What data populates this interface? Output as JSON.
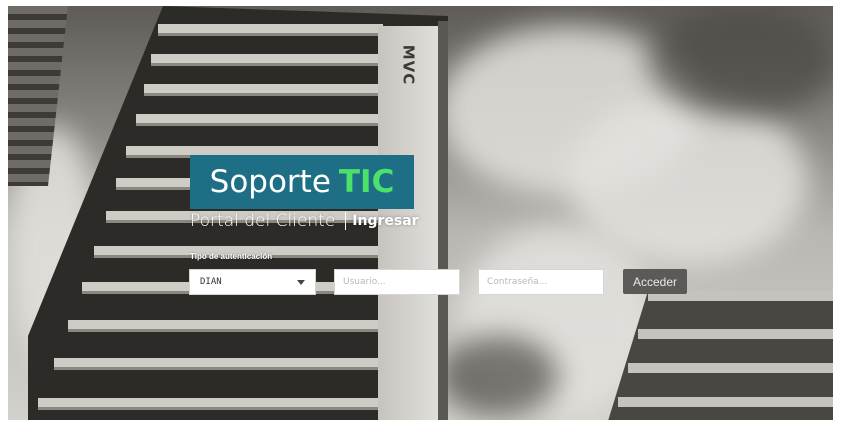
{
  "brand": {
    "name": "Soporte",
    "highlight": "TIC",
    "box_color": "#1e6f86",
    "highlight_color": "#4be26a"
  },
  "subtitle": {
    "text": "Portal del Cliente",
    "link": "Ingresar"
  },
  "login": {
    "auth_type_label": "Tipo de autenticación",
    "auth_type_value": "DIAN",
    "username_placeholder": "Usuario...",
    "password_placeholder": "Contraseña...",
    "submit_label": "Acceder"
  },
  "background": {
    "building_sign": "MVC"
  },
  "icons": {
    "select_caret": "caret-down-icon"
  }
}
